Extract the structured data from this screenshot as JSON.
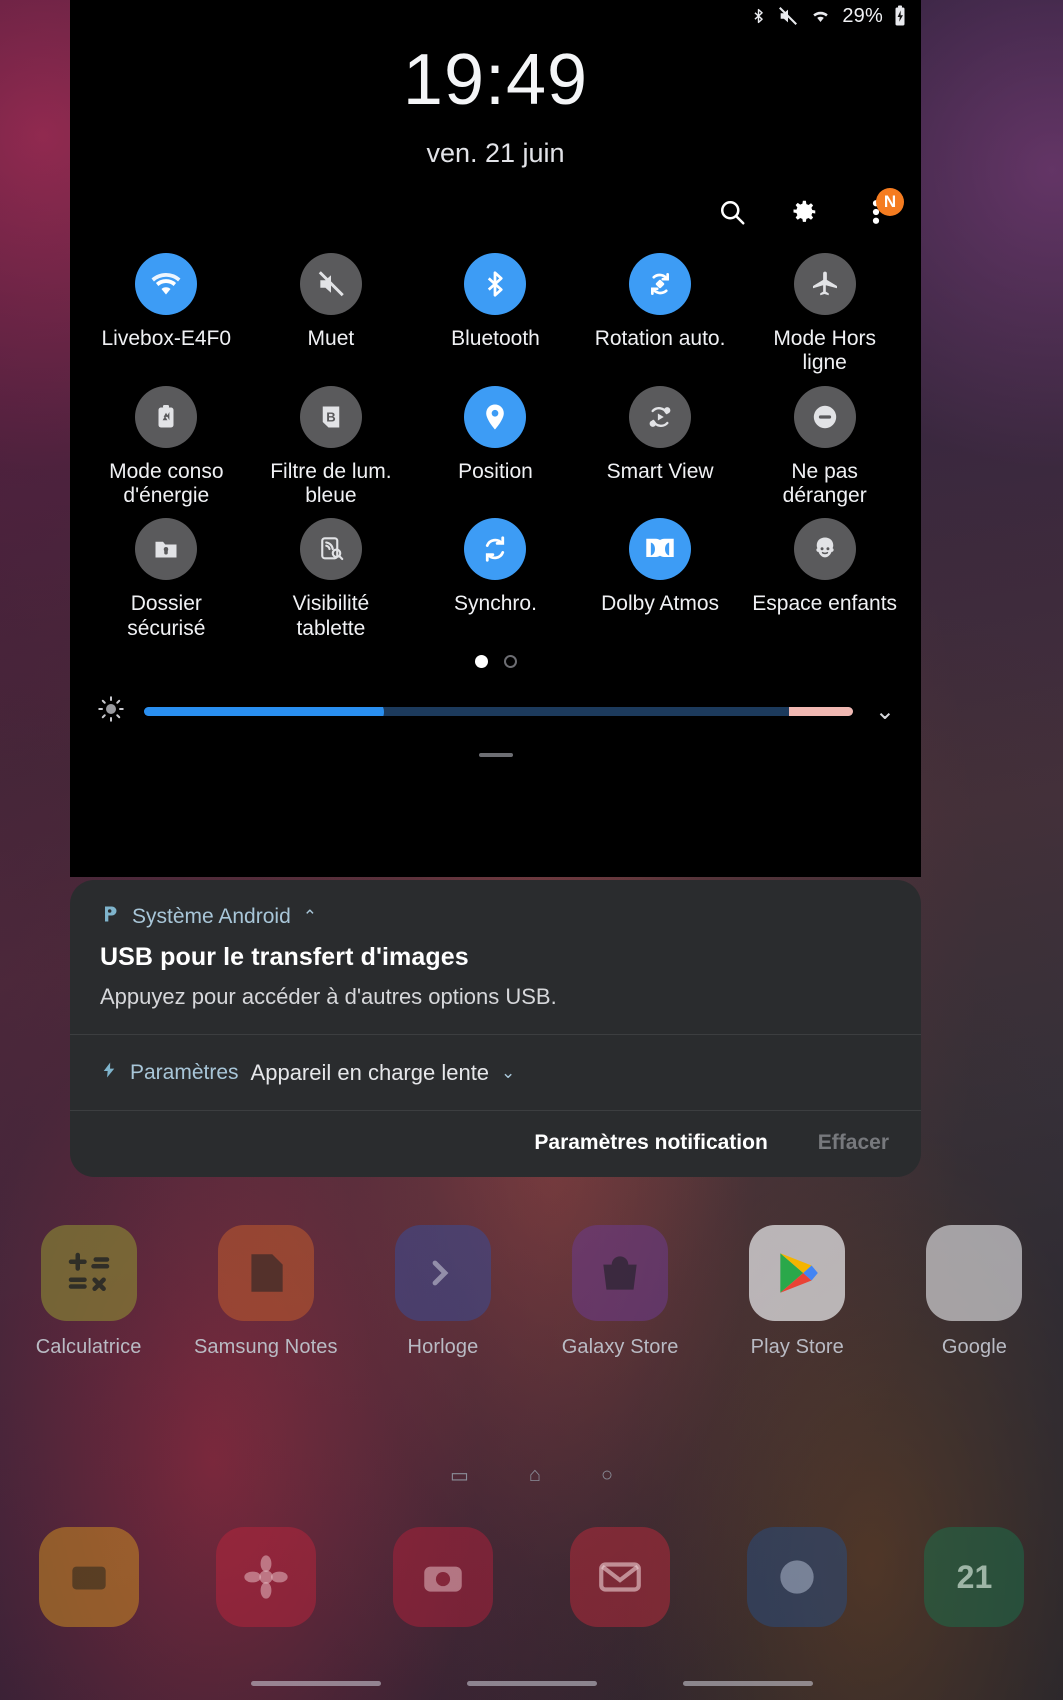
{
  "status_bar": {
    "icons": [
      "bluetooth-icon",
      "mute-icon",
      "wifi-icon"
    ],
    "battery_percent": "29%",
    "battery_state": "charging"
  },
  "clock": {
    "time": "19:49",
    "date": "ven. 21 juin"
  },
  "toolbar": {
    "search": "search-icon",
    "settings": "gear-icon",
    "menu": "overflow-menu-icon",
    "menu_badge": "N"
  },
  "tiles": {
    "rows": [
      [
        {
          "label": "Livebox-E4F0",
          "icon": "wifi-icon",
          "state": "on"
        },
        {
          "label": "Muet",
          "icon": "volume-mute-icon",
          "state": "off"
        },
        {
          "label": "Bluetooth",
          "icon": "bluetooth-icon",
          "state": "on"
        },
        {
          "label": "Rotation auto.",
          "icon": "auto-rotate-icon",
          "state": "on"
        },
        {
          "label": "Mode Hors ligne",
          "icon": "airplane-icon",
          "state": "off"
        }
      ],
      [
        {
          "label": "Mode conso d'énergie",
          "icon": "power-saving-icon",
          "state": "off"
        },
        {
          "label": "Filtre de lum. bleue",
          "icon": "blue-light-filter-icon",
          "state": "off"
        },
        {
          "label": "Position",
          "icon": "location-pin-icon",
          "state": "on"
        },
        {
          "label": "Smart View",
          "icon": "smart-view-icon",
          "state": "off"
        },
        {
          "label": "Ne pas déranger",
          "icon": "do-not-disturb-icon",
          "state": "off"
        }
      ],
      [
        {
          "label": "Dossier sécurisé",
          "icon": "secure-folder-icon",
          "state": "off"
        },
        {
          "label": "Visibilité tablette",
          "icon": "tablet-visibility-icon",
          "state": "off"
        },
        {
          "label": "Synchro.",
          "icon": "sync-icon",
          "state": "on"
        },
        {
          "label": "Dolby Atmos",
          "icon": "dolby-icon",
          "state": "on"
        },
        {
          "label": "Espace enfants",
          "icon": "kids-mode-icon",
          "state": "off"
        }
      ]
    ],
    "pages": {
      "total": 2,
      "current": 1
    }
  },
  "brightness": {
    "icon": "brightness-icon",
    "value_percent": 32,
    "extra_zone_percent": 9,
    "expand": "chevron-down-icon"
  },
  "notifications": {
    "primary": {
      "app": "Système Android",
      "app_icon": "android-system-icon",
      "collapse_icon": "chevron-up-icon",
      "title": "USB pour le transfert d'images",
      "body": "Appuyez pour accéder à d'autres options USB."
    },
    "secondary": {
      "app": "Paramètres",
      "app_icon": "charging-bolt-icon",
      "text": "Appareil en charge lente",
      "expand_icon": "chevron-down-icon"
    },
    "footer": {
      "settings_label": "Paramètres notification",
      "clear_label": "Effacer"
    }
  },
  "home_screen": {
    "row1": [
      {
        "label": "Calculatrice",
        "icon": "calculator-icon",
        "color": "#8a8a33"
      },
      {
        "label": "Samsung Notes",
        "icon": "notes-icon",
        "color": "#b5562e"
      },
      {
        "label": "Horloge",
        "icon": "clock-app-icon",
        "color": "#3d4a8c"
      },
      {
        "label": "Galaxy Store",
        "icon": "galaxy-store-icon",
        "color": "#6a3a86"
      },
      {
        "label": "Play Store",
        "icon": "play-store-icon",
        "color": "#e8e8ea"
      },
      {
        "label": "Google",
        "icon": "google-folder-icon",
        "color": "#d8d8dc"
      }
    ],
    "row2": [
      {
        "label": "",
        "icon": "my-files-icon",
        "color": "#c98a22"
      },
      {
        "label": "",
        "icon": "gallery-icon",
        "color": "#b3243c"
      },
      {
        "label": "",
        "icon": "camera-icon",
        "color": "#a8203a"
      },
      {
        "label": "",
        "icon": "email-icon",
        "color": "#b02a3a"
      },
      {
        "label": "",
        "icon": "internet-icon",
        "color": "#2a4a7a"
      },
      {
        "label": "21",
        "icon": "calendar-icon",
        "color": "#1e6b48"
      }
    ]
  },
  "nav_bar": {
    "recents": "recents-icon",
    "home": "home-icon",
    "back": "back-icon"
  },
  "colors": {
    "accent_blue": "#3d9cf5",
    "tile_off": "#5a5a5c",
    "badge_orange": "#f57c20",
    "shade_bg": "#2a2c2e",
    "link_blue": "#a8c6d8"
  }
}
